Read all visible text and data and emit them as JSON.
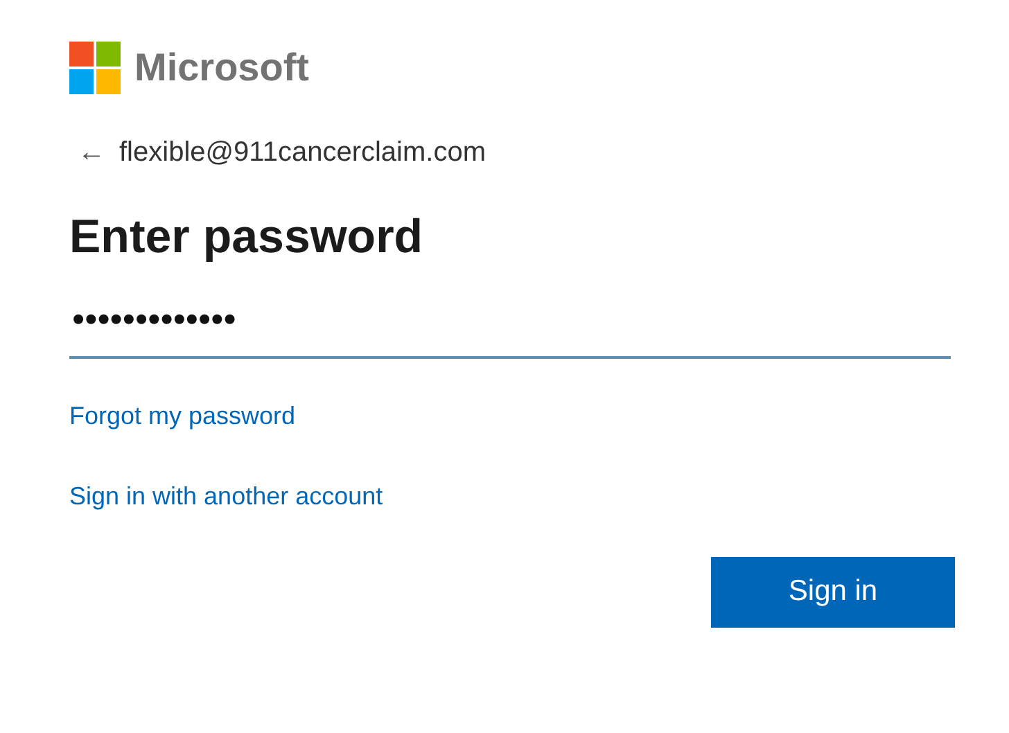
{
  "brand": {
    "name": "Microsoft"
  },
  "identity": {
    "back": "←",
    "email": "flexible@911cancerclaim.com"
  },
  "title": "Enter password",
  "password_field": {
    "value": "•••••••••••••"
  },
  "links": [
    {
      "label": "Forgot my password"
    },
    {
      "label": "Sign in with another account"
    }
  ],
  "buttons": [
    {
      "label": "Sign in"
    }
  ]
}
